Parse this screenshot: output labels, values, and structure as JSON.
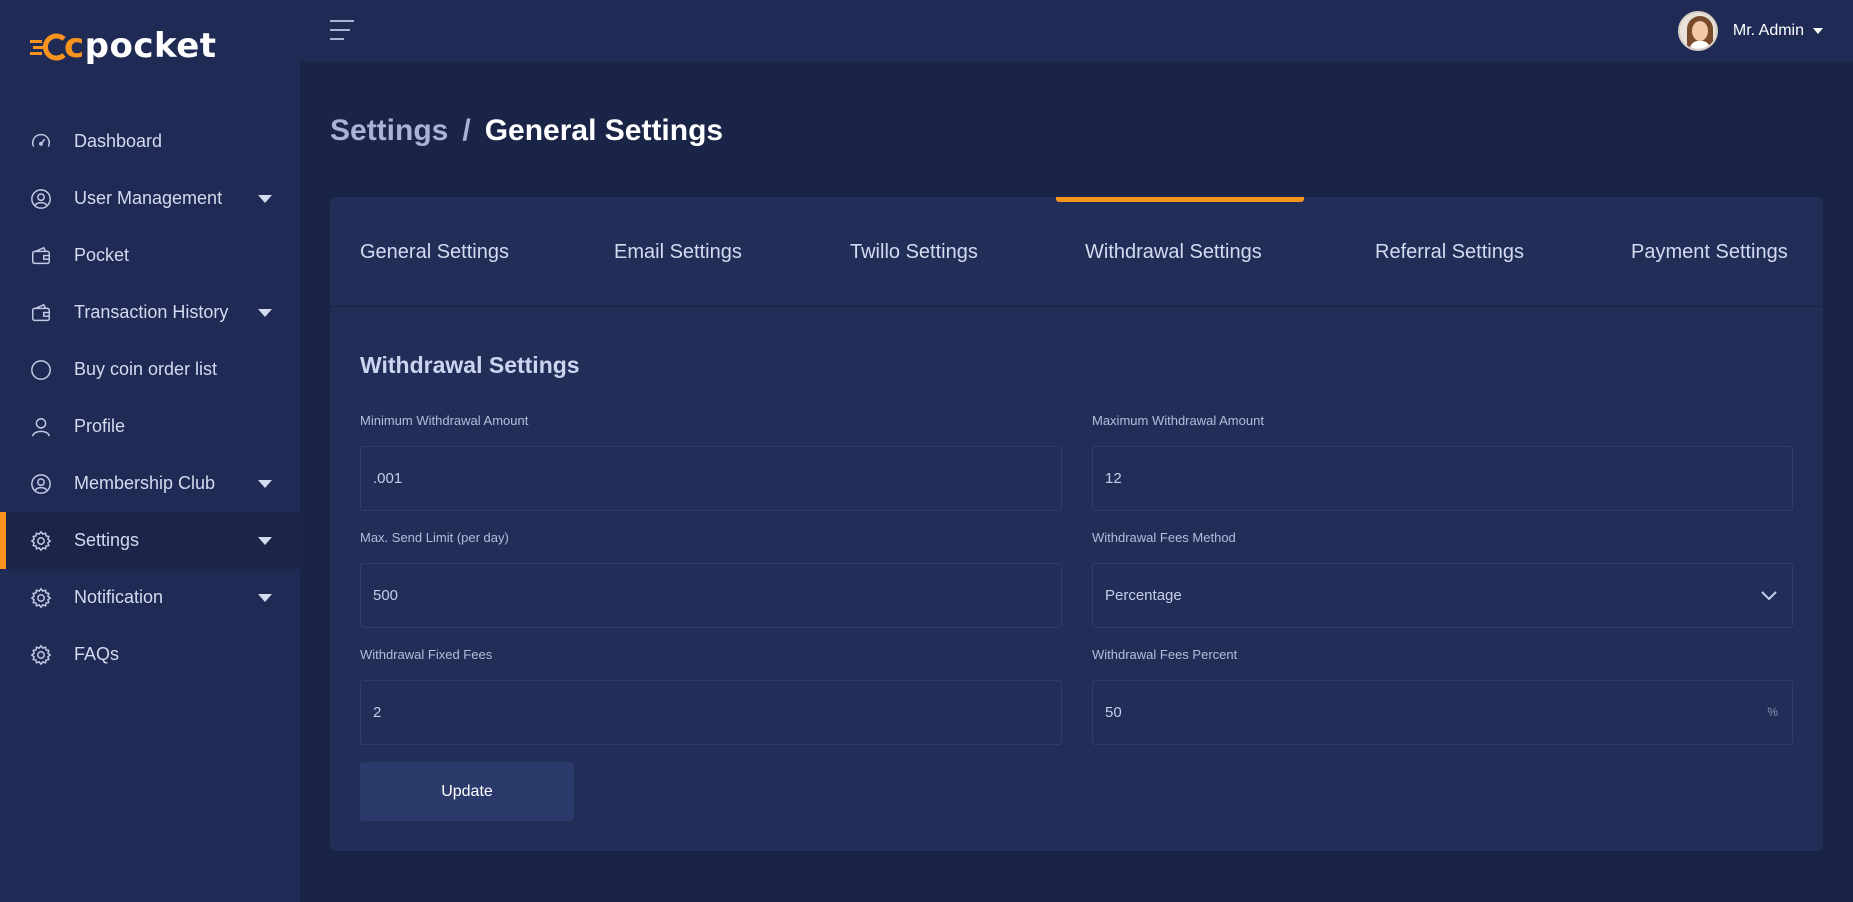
{
  "brand": {
    "logo_prefix": "c",
    "logo_suffix": "pocket"
  },
  "topbar": {
    "user_name": "Mr. Admin"
  },
  "sidebar": {
    "items": [
      {
        "label": "Dashboard",
        "icon": "speedometer-icon",
        "has_caret": false,
        "active": false
      },
      {
        "label": "User Management",
        "icon": "user-circle-icon",
        "has_caret": true,
        "active": false
      },
      {
        "label": "Pocket",
        "icon": "wallet-icon",
        "has_caret": false,
        "active": false
      },
      {
        "label": "Transaction History",
        "icon": "wallet-icon",
        "has_caret": true,
        "active": false
      },
      {
        "label": "Buy coin order list",
        "icon": "circle-icon",
        "has_caret": false,
        "active": false
      },
      {
        "label": "Profile",
        "icon": "person-icon",
        "has_caret": false,
        "active": false
      },
      {
        "label": "Membership Club",
        "icon": "user-circle-icon",
        "has_caret": true,
        "active": false
      },
      {
        "label": "Settings",
        "icon": "gear-icon",
        "has_caret": true,
        "active": true
      },
      {
        "label": "Notification",
        "icon": "gear-icon",
        "has_caret": true,
        "active": false
      },
      {
        "label": "FAQs",
        "icon": "gear-icon",
        "has_caret": false,
        "active": false
      }
    ]
  },
  "breadcrumb": {
    "parent": "Settings",
    "separator": "/",
    "current": "General Settings"
  },
  "tabs": [
    {
      "label": "General Settings",
      "active": false
    },
    {
      "label": "Email Settings",
      "active": false
    },
    {
      "label": "Twillo Settings",
      "active": false
    },
    {
      "label": "Withdrawal Settings",
      "active": true
    },
    {
      "label": "Referral Settings",
      "active": false
    },
    {
      "label": "Payment Settings",
      "active": false
    }
  ],
  "form": {
    "title": "Withdrawal Settings",
    "min_withdrawal": {
      "label": "Minimum Withdrawal Amount",
      "value": ".001"
    },
    "max_withdrawal": {
      "label": "Maximum Withdrawal Amount",
      "value": "12"
    },
    "max_send_limit": {
      "label": "Max. Send Limit (per day)",
      "value": "500"
    },
    "fees_method": {
      "label": "Withdrawal Fees Method",
      "value": "Percentage"
    },
    "fixed_fees": {
      "label": "Withdrawal Fixed Fees",
      "value": "2"
    },
    "fees_percent": {
      "label": "Withdrawal Fees Percent",
      "value": "50",
      "suffix": "%"
    },
    "update_label": "Update"
  },
  "colors": {
    "accent": "#f7931e",
    "sidebar_bg": "#1f2b54",
    "page_bg": "#1a2447",
    "card_bg": "#212e58"
  }
}
